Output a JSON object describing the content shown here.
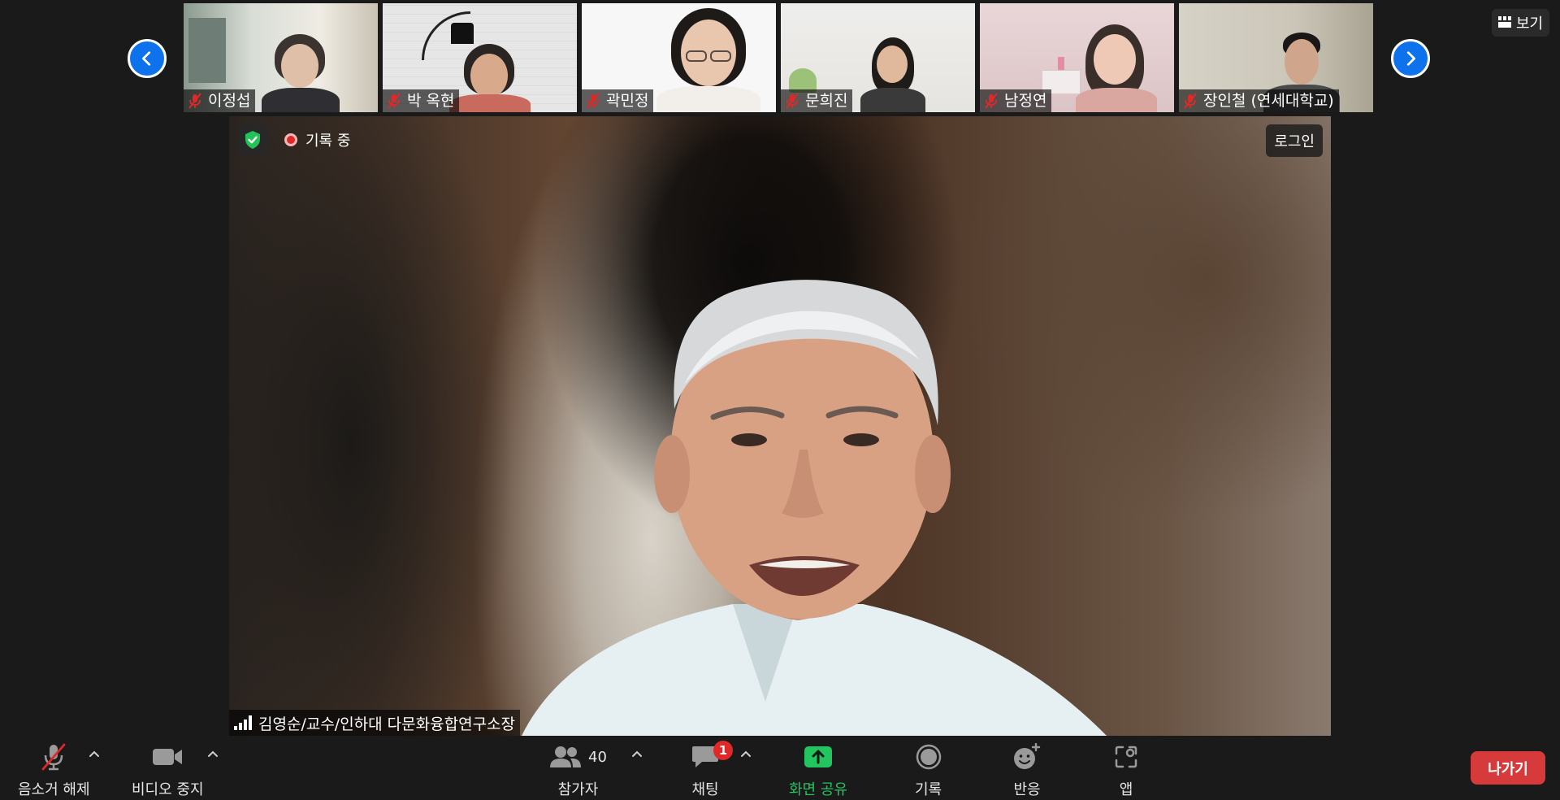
{
  "window": {
    "view_label": "보기"
  },
  "thumbnails": [
    {
      "name": "이정섭",
      "muted": true
    },
    {
      "name": "박 옥현",
      "muted": true
    },
    {
      "name": "곽민정",
      "muted": true
    },
    {
      "name": "문희진",
      "muted": true
    },
    {
      "name": "남정연",
      "muted": true
    },
    {
      "name": "장인철 (연세대학교)",
      "muted": true
    }
  ],
  "main_video": {
    "recording_label": "기록 중",
    "login_label": "로그인",
    "speaker_name": "김영순/교수/인하대 다문화융합연구소장"
  },
  "toolbar": {
    "unmute_label": "음소거 해제",
    "video_label": "비디오 중지",
    "participants_label": "참가자",
    "participants_count": "40",
    "chat_label": "채팅",
    "chat_unread": "1",
    "share_label": "화면 공유",
    "record_label": "기록",
    "reactions_label": "반응",
    "apps_label": "앱",
    "leave_label": "나가기"
  },
  "colors": {
    "accent_blue": "#0e72ed",
    "share_green": "#22c55e",
    "leave_red": "#d63a3a",
    "muted_red": "#e02828"
  }
}
